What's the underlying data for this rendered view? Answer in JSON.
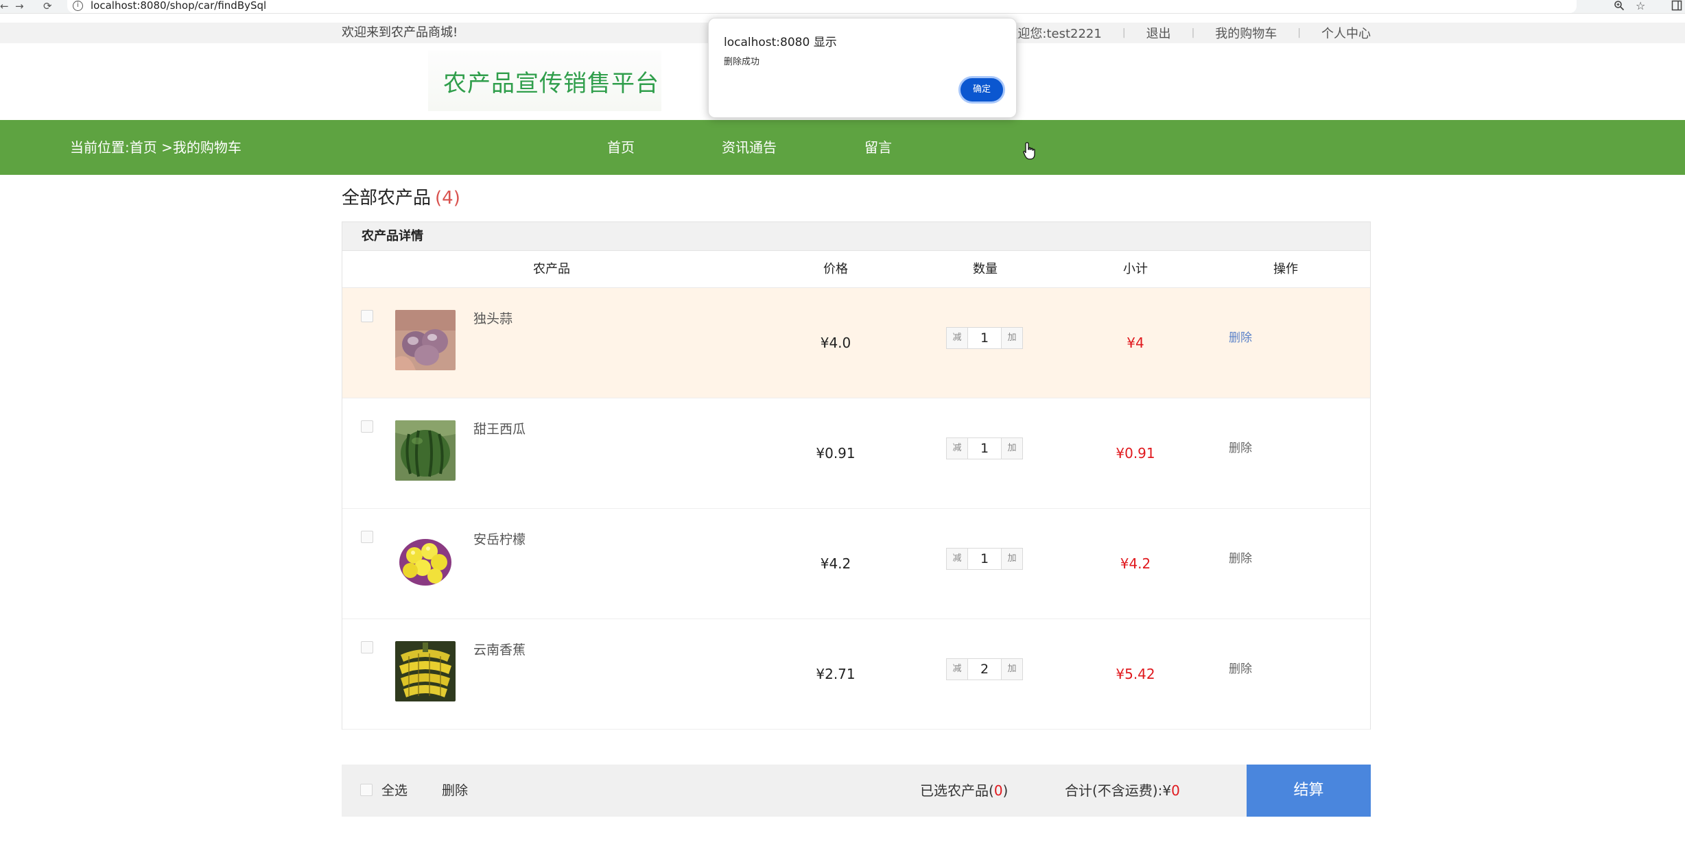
{
  "browser": {
    "back": "←",
    "forward": "→",
    "reload": "⟳",
    "info": "i",
    "url": "localhost:8080/shop/car/findBySql",
    "zoom_icon": "zoom-icon",
    "star_icon": "star-icon"
  },
  "top": {
    "welcome": "欢迎来到农产品商城!",
    "greeting": "欢迎您:test2221",
    "logout": "退出",
    "my_cart": "我的购物车",
    "personal": "个人中心",
    "separator": "|"
  },
  "logo": {
    "text": "农产品宣传销售平台"
  },
  "nav": {
    "crumb": "当前位置:首页 >我的购物车",
    "items": [
      "首页",
      "资讯通告",
      "留言"
    ]
  },
  "section": {
    "title": "全部农产品",
    "count": "(4)"
  },
  "table": {
    "head": "农产品详情",
    "columns": [
      "农产品",
      "价格",
      "数量",
      "小计",
      "操作"
    ],
    "minus_label": "减",
    "plus_label": "加",
    "rows": [
      {
        "name": "独头蒜",
        "price": "¥4.0",
        "qty": "1",
        "subtotal": "¥4",
        "action": "删除"
      },
      {
        "name": "甜王西瓜",
        "price": "¥0.91",
        "qty": "1",
        "subtotal": "¥0.91",
        "action": "删除"
      },
      {
        "name": "安岳柠檬",
        "price": "¥4.2",
        "qty": "1",
        "subtotal": "¥4.2",
        "action": "删除"
      },
      {
        "name": "云南香蕉",
        "price": "¥2.71",
        "qty": "2",
        "subtotal": "¥5.42",
        "action": "删除"
      }
    ]
  },
  "footer": {
    "select_all": "全选",
    "delete": "删除",
    "selected_label": "已选农产品(",
    "selected_count": "0",
    "selected_close": ")",
    "total_label": "合计(不含运费):¥",
    "total_value": "0",
    "checkout": "结算"
  },
  "dialog": {
    "title": "localhost:8080 显示",
    "message": "删除成功",
    "ok": "确定"
  },
  "colors": {
    "nav_green": "#5ea341",
    "logo_green": "#2f9e4b",
    "price_red": "#e0191e",
    "checkout_blue": "#4a86dd",
    "highlight_row": "#fff4e8",
    "dialog_button": "#0b57d0"
  }
}
